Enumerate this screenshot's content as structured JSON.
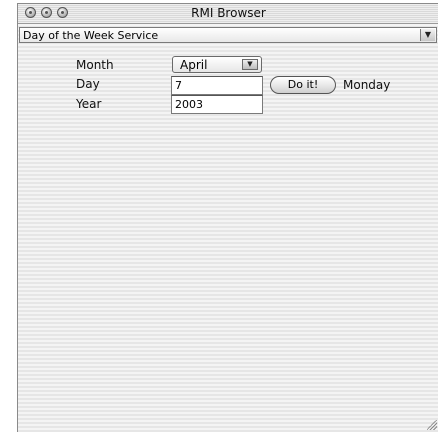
{
  "window": {
    "title": "RMI Browser"
  },
  "service": {
    "selected": "Day of the Week Service",
    "arrow_icon": "▼"
  },
  "form": {
    "month_label": "Month",
    "day_label": "Day",
    "year_label": "Year",
    "month_value": "April",
    "month_arrow_icon": "▼",
    "day_value": "7",
    "year_value": "2003",
    "submit_label": "Do it!",
    "result": "Monday"
  }
}
